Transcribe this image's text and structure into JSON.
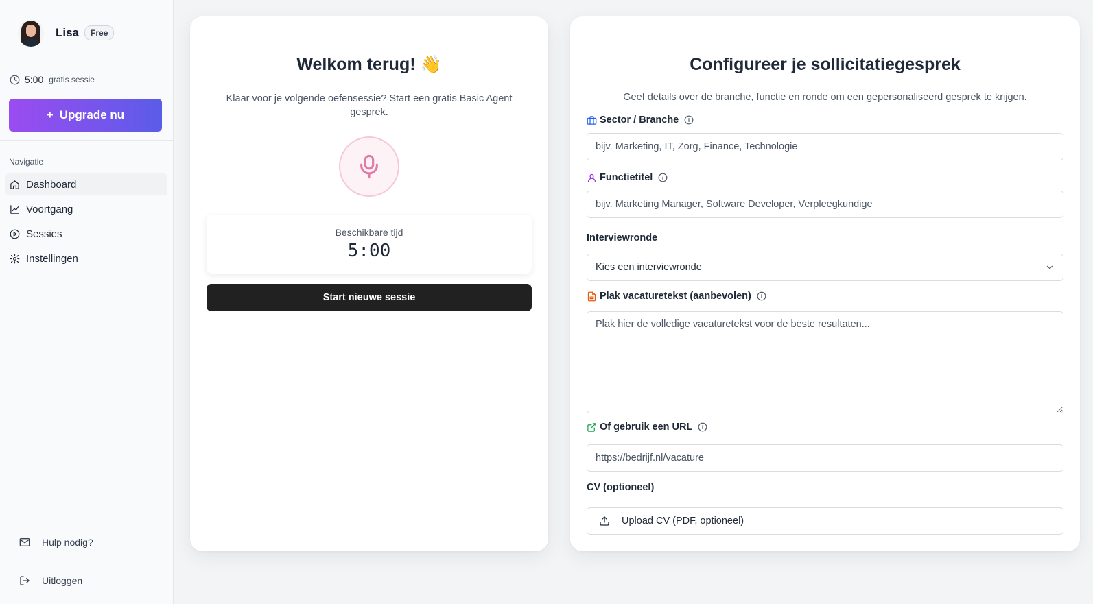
{
  "user": {
    "name": "Lisa",
    "plan": "Free"
  },
  "session_timer": {
    "value": "5:00",
    "label": "gratis sessie"
  },
  "sidebar": {
    "upgrade_label": "Upgrade nu",
    "upgrade_plus": "+",
    "nav_heading": "Navigatie",
    "items": [
      {
        "label": "Dashboard",
        "icon": "home-icon",
        "active": true
      },
      {
        "label": "Voortgang",
        "icon": "line-chart-icon"
      },
      {
        "label": "Sessies",
        "icon": "play-circle-icon"
      },
      {
        "label": "Instellingen",
        "icon": "gear-icon"
      }
    ],
    "help_label": "Hulp nodig?",
    "logout_label": "Uitloggen"
  },
  "welcome": {
    "title": "Welkom terug! 👋",
    "subtitle": "Klaar voor je volgende oefensessie? Start een gratis Basic Agent gesprek.",
    "time_label": "Beschikbare tijd",
    "time_value": "5:00",
    "start_label": "Start nieuwe sessie"
  },
  "config": {
    "title": "Configureer je sollicitatiegesprek",
    "subtitle": "Geef details over de branche, functie en ronde om een gepersonaliseerd gesprek te krijgen.",
    "sector": {
      "label": "Sector / Branche",
      "placeholder": "bijv. Marketing, IT, Zorg, Finance, Technologie",
      "icon_color": "#2563eb"
    },
    "job_title": {
      "label": "Functietitel",
      "placeholder": "bijv. Marketing Manager, Software Developer, Verpleegkundige",
      "icon_color": "#9333ea"
    },
    "round": {
      "label": "Interviewronde",
      "selected": "Kies een interviewronde"
    },
    "vacancy_text": {
      "label": "Plak vacaturetekst (aanbevolen)",
      "placeholder": "Plak hier de volledige vacaturetekst voor de beste resultaten...",
      "icon_color": "#ea580c"
    },
    "url": {
      "label": "Of gebruik een URL",
      "placeholder": "https://bedrijf.nl/vacature",
      "icon_color": "#16a34a"
    },
    "cv": {
      "label": "CV (optioneel)",
      "upload_label": "Upload CV (PDF, optioneel)"
    }
  },
  "colors": {
    "upgrade_start": "#9b4cf0",
    "upgrade_end": "#5b5ce8",
    "mic_accent": "#e07aa6",
    "start_button": "#212121"
  }
}
